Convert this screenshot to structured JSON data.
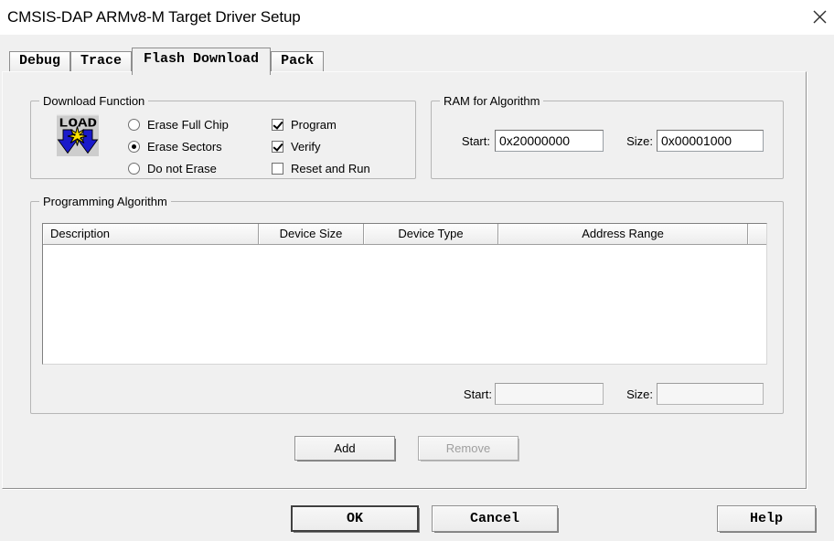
{
  "window": {
    "title": "CMSIS-DAP ARMv8-M Target Driver Setup"
  },
  "icons": {
    "close": "close-icon",
    "load": "load-icon"
  },
  "tabs": [
    {
      "label": "Debug",
      "active": false
    },
    {
      "label": "Trace",
      "active": false
    },
    {
      "label": "Flash Download",
      "active": true
    },
    {
      "label": "Pack",
      "active": false
    }
  ],
  "download_function": {
    "legend": "Download Function",
    "erase_options": [
      {
        "label": "Erase Full Chip",
        "selected": false
      },
      {
        "label": "Erase Sectors",
        "selected": true
      },
      {
        "label": "Do not Erase",
        "selected": false
      }
    ],
    "flags": [
      {
        "label": "Program",
        "checked": true
      },
      {
        "label": "Verify",
        "checked": true
      },
      {
        "label": "Reset and Run",
        "checked": false
      }
    ]
  },
  "ram_for_algorithm": {
    "legend": "RAM for Algorithm",
    "start_label": "Start:",
    "start_value": "0x20000000",
    "size_label": "Size:",
    "size_value": "0x00001000"
  },
  "programming_algorithm": {
    "legend": "Programming Algorithm",
    "table": {
      "headers": [
        "Description",
        "Device Size",
        "Device Type",
        "Address Range",
        ""
      ],
      "rows": []
    },
    "start_label": "Start:",
    "start_value": "",
    "size_label": "Size:",
    "size_value": "",
    "add_label": "Add",
    "remove_label": "Remove"
  },
  "footer": {
    "ok": "OK",
    "cancel": "Cancel",
    "help": "Help"
  },
  "colors": {
    "dialog_bg": "#f0f0f0",
    "titlebar_bg": "#ffffff",
    "load_blue": "#1a1acb",
    "load_yellow": "#ffe400"
  }
}
